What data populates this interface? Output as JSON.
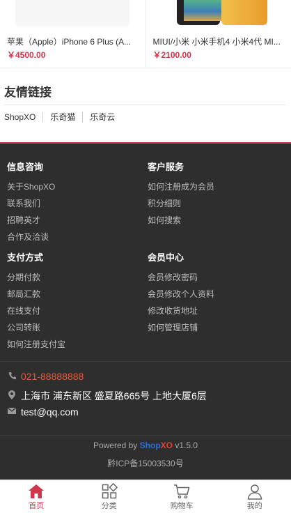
{
  "products": [
    {
      "title": "苹果（Apple）iPhone 6 Plus (A...",
      "price": "￥4500.00"
    },
    {
      "title": "MIUI/小米 小米手机4 小米4代 MI...",
      "price": "￥2100.00"
    }
  ],
  "friends": {
    "heading": "友情链接",
    "links": [
      "ShopXO",
      "乐奇猫",
      "乐奇云"
    ]
  },
  "footer": {
    "columns": [
      {
        "title": "信息咨询",
        "items": [
          "关于ShopXO",
          "联系我们",
          "招聘英才",
          "合作及洽谈"
        ]
      },
      {
        "title": "客户服务",
        "items": [
          "如何注册成为会员",
          "积分细则",
          "如何搜索"
        ]
      },
      {
        "title": "支付方式",
        "items": [
          "分期付款",
          "邮局汇款",
          "在线支付",
          "公司转账",
          "如何注册支付宝"
        ]
      },
      {
        "title": "会员中心",
        "items": [
          "会员修改密码",
          "会员修改个人资料",
          "修改收货地址",
          "如何管理店铺"
        ]
      }
    ],
    "contact": {
      "phone": "021-88888888",
      "address": "上海市 浦东新区 盛夏路665号 上地大厦6层",
      "email": "test@qq.com"
    },
    "powered_prefix": "Powered by",
    "brand_shop": "Shop",
    "brand_xo": "XO",
    "version": "v1.5.0",
    "icp": "黔ICP备15003530号"
  },
  "tabbar": [
    {
      "label": "首页",
      "icon": "home-icon",
      "active": true
    },
    {
      "label": "分类",
      "icon": "category-icon",
      "active": false
    },
    {
      "label": "购物车",
      "icon": "cart-icon",
      "active": false
    },
    {
      "label": "我的",
      "icon": "user-icon",
      "active": false
    }
  ],
  "colors": {
    "accent": "#d2364c",
    "footer_bg": "#2f2e2e",
    "phone_text": "#e25d3f"
  }
}
